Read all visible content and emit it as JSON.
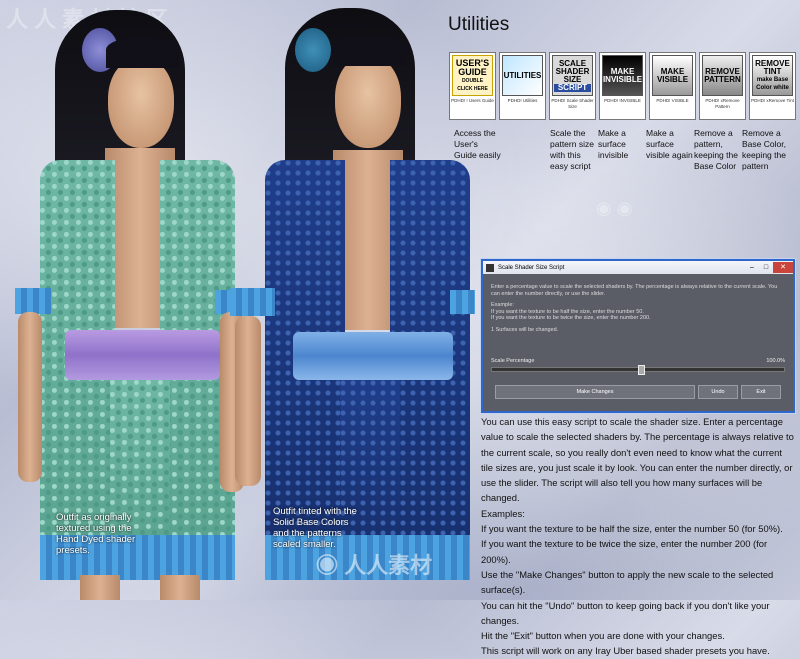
{
  "watermark": {
    "top_text": "人人素材社区",
    "bottom_text": "人人素材"
  },
  "captions": {
    "left": "Outfit as originally textured using the Hand Dyed shader presets.",
    "right": "Outfit tinted with the Solid Base Colors and the patterns scaled smaller."
  },
  "utilities": {
    "title": "Utilities",
    "tools": [
      {
        "icon": "users-guide-icon",
        "label_lines": [
          "USER'S",
          "GUIDE",
          "DOUBLE",
          "CLICK HERE"
        ],
        "caption": "PDHD! ! Users Guide",
        "description": "Access the User's Guide easily"
      },
      {
        "icon": "utilities-icon",
        "label_lines": [
          "UTILITIES"
        ],
        "caption": "PDHD! Utilities",
        "description": ""
      },
      {
        "icon": "scale-shader-icon",
        "label_lines": [
          "SCALE",
          "SHADER",
          "SIZE",
          "SCRIPT"
        ],
        "caption": "PDHD! Scale Shader Size",
        "description": "Scale the pattern size with this easy script"
      },
      {
        "icon": "make-invisible-icon",
        "label_lines": [
          "MAKE",
          "INVISIBLE"
        ],
        "caption": "PDHD! INVISIBLE",
        "description": "Make a surface invisible"
      },
      {
        "icon": "make-visible-icon",
        "label_lines": [
          "MAKE",
          "VISIBLE"
        ],
        "caption": "PDHD! VISIBLE",
        "description": "Make a surface visible again"
      },
      {
        "icon": "remove-pattern-icon",
        "label_lines": [
          "REMOVE",
          "PATTERN"
        ],
        "caption": "PDHD! xRemove Pattern",
        "description": "Remove a pattern, keeping the Base Color"
      },
      {
        "icon": "remove-tint-icon",
        "label_lines": [
          "REMOVE",
          "TINT",
          "make Base",
          "Color white"
        ],
        "caption": "PDHD! xRemove Tint",
        "description": "Remove a Base Color, keeping the pattern"
      }
    ]
  },
  "dialog": {
    "title": "Scale Shader Size Script",
    "window_buttons": {
      "minimize": "–",
      "maximize": "□",
      "close": "✕"
    },
    "intro": "Enter a percentage value to scale the selected shaders by. The percentage is always relative to the current scale. You can enter the number directly, or use the slider.",
    "example_heading": "Example:",
    "example_half": "If you want the texture to be half the size, enter the number 50.",
    "example_double": "If you want the texture to be twice the size, enter the number 200.",
    "surfaces": "1 Surfaces will be changed.",
    "slider_label": "Scale Percentage",
    "slider_value": "100.0%",
    "slider_fraction": 0.5,
    "buttons": {
      "apply": "Make Changes",
      "undo": "Undo",
      "exit": "Exit"
    }
  },
  "body_text": [
    "You can use this easy script to scale the shader size. Enter a percentage value to scale the selected shaders by. The percentage is always relative to the current scale, so you really don't even need to know what the current tile sizes are, you just scale it by look. You can enter the number directly, or use the slider. The script will also tell you how many surfaces will be changed.",
    "Examples:",
    "If you want the texture to be half the size, enter the number 50 (for 50%).",
    "If you want the texture to be twice the size, enter the number 200 (for 200%).",
    "Use the \"Make Changes\" button to apply the new scale to the selected surface(s).",
    "You can hit the \"Undo\" button to keep going back if you don't like your changes.",
    "Hit the \"Exit\" button when you are done with your changes.",
    "This script will work on any Iray Uber based shader presets you have."
  ],
  "colors": {
    "dialog_border": "#2f66c9",
    "robe_green": "#6fb8a6",
    "robe_blue": "#1f3d8a",
    "sash_purple": "#8f72c9"
  }
}
